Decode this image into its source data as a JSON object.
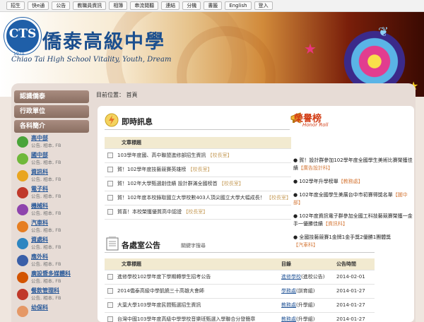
{
  "nav": [
    "招生",
    "快e通",
    "公告",
    "教職員資訊",
    "相簿",
    "串流閱聽",
    "連結",
    "分機",
    "書籤",
    "English",
    "登入"
  ],
  "banner": {
    "title": "僑泰高級中學",
    "logo": "CTS",
    "year": "1970",
    "subtitle": "Chiao Tai High School  Vitality, Youth, Dream"
  },
  "breadcrumb": "目前位置： 首頁",
  "sidebar": {
    "headers": [
      "認識僑泰",
      "行政單位",
      "各科簡介"
    ],
    "depts": [
      {
        "name": "高中部",
        "links": "公告, 相本, FB",
        "color": "#4aa43a"
      },
      {
        "name": "國中部",
        "links": "公告, 相本, FB",
        "color": "#6fb83a"
      },
      {
        "name": "資訊科",
        "links": "公告, 相本, FB",
        "color": "#e9a520"
      },
      {
        "name": "電子科",
        "links": "公告, 相本, FB",
        "color": "#c0392b"
      },
      {
        "name": "機械科",
        "links": "公告, 相本, FB",
        "color": "#8e44ad"
      },
      {
        "name": "汽車科",
        "links": "公告, 相本, FB",
        "color": "#e67e22"
      },
      {
        "name": "資處科",
        "links": "公告, 相本, FB",
        "color": "#2e86c1"
      },
      {
        "name": "應外科",
        "links": "公告, 相本, FB",
        "color": "#3a5fa8"
      },
      {
        "name": "廣設暨多媒體科",
        "links": "公告, 相本, FB",
        "color": "#d35400"
      },
      {
        "name": "餐飲管理科",
        "links": "公告, 相本, FB",
        "color": "#c0392b"
      },
      {
        "name": "幼保科",
        "links": "",
        "color": "#e59866"
      }
    ]
  },
  "news": {
    "title": "即時訊息",
    "header": "文章標題",
    "rows": [
      {
        "text": "103學年度國、高中聯盟進修部招生資訊",
        "tag": "【校長室】"
      },
      {
        "text": "賀！102學年度技藝競賽英雄榜",
        "tag": "【校長室】"
      },
      {
        "text": "賀！102年大學甄選創佳績 設計群滿全國榜首",
        "tag": "【校長室】"
      },
      {
        "text": "賀！102年度本校錄取國立大學校數403人頂尖國立大學大幅成長！",
        "tag": "【校長室】"
      },
      {
        "text": "賀喜！本校榮獲優質高中認證",
        "tag": "【校長室】"
      }
    ]
  },
  "announce": {
    "title": "各處室公告",
    "keyword_link": "關鍵字搜尋",
    "headers": [
      "文章標題",
      "目錄",
      "公告時間"
    ],
    "rows": [
      {
        "text": "進修學校102學年度下學期轉學生招考公告",
        "dept": "進修學校",
        "cat": "(進校公告)",
        "date": "2014-02-01"
      },
      {
        "text": "2014僑泰高級中學凱饒三十高雄大會師",
        "dept": "學務處",
        "cat": "(訓育組)",
        "date": "2014-01-27"
      },
      {
        "text": "大葉大學103學年度民間甄選招生資訊",
        "dept": "教務處",
        "cat": "(升學組)",
        "date": "2014-01-27"
      },
      {
        "text": "台灣中國103學年度高級中學學校音樂班甄選入學聯合分發簡章",
        "dept": "教務處",
        "cat": "(升學組)",
        "date": "2014-01-27"
      }
    ]
  },
  "honor": {
    "title": "榮譽榜",
    "subtitle": "Honor Roll",
    "items": [
      {
        "text": "賀！設計群參加102學年度全國學生美術比賽榮獲佳績",
        "tag": "【廣告設計科】"
      },
      {
        "text": "102學年升學榜單",
        "tag": "【教務處】"
      },
      {
        "text": "102年度全國學生美展台中市初賽得獎名單",
        "tag": "【圖中部】"
      },
      {
        "text": "102年度資訊電子群參加全國工科技藝競賽榮獲一金手一優勝佳績",
        "tag": "【資訊科】"
      },
      {
        "text": "全國技藝競賽1金牌1金手獎2優勝1團體獎",
        "tag": "【汽車科】"
      }
    ]
  }
}
